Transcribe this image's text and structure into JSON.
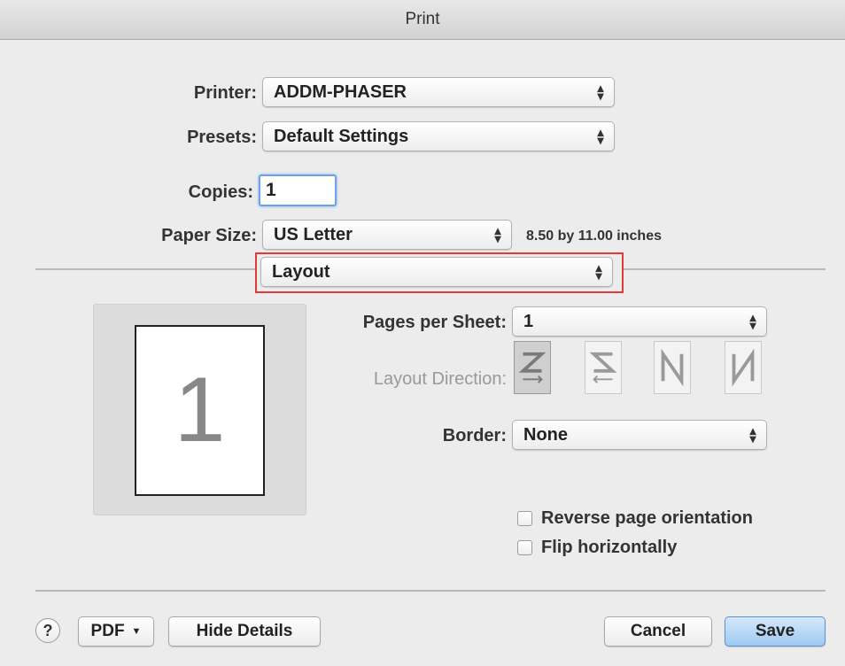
{
  "window": {
    "title": "Print"
  },
  "printer": {
    "label": "Printer:",
    "value": "ADDM-PHASER"
  },
  "presets": {
    "label": "Presets:",
    "value": "Default Settings"
  },
  "copies": {
    "label": "Copies:",
    "value": "1"
  },
  "paper_size": {
    "label": "Paper Size:",
    "value": "US Letter",
    "dimensions": "8.50 by 11.00 inches"
  },
  "section_popup": {
    "value": "Layout"
  },
  "preview": {
    "page_number": "1"
  },
  "pages_per_sheet": {
    "label": "Pages per Sheet:",
    "value": "1"
  },
  "layout_direction": {
    "label": "Layout Direction:",
    "options": [
      "z-order",
      "reverse-z-order",
      "n-order",
      "reverse-n-order"
    ],
    "selected_index": 0
  },
  "border": {
    "label": "Border:",
    "value": "None"
  },
  "options": {
    "reverse_orientation": "Reverse page orientation",
    "flip_horizontally": "Flip horizontally"
  },
  "footer": {
    "help": "?",
    "pdf": "PDF",
    "hide_details": "Hide Details",
    "cancel": "Cancel",
    "save": "Save"
  },
  "colors": {
    "highlight": "#e03b3b",
    "primary_button": "#9dc8f2"
  }
}
